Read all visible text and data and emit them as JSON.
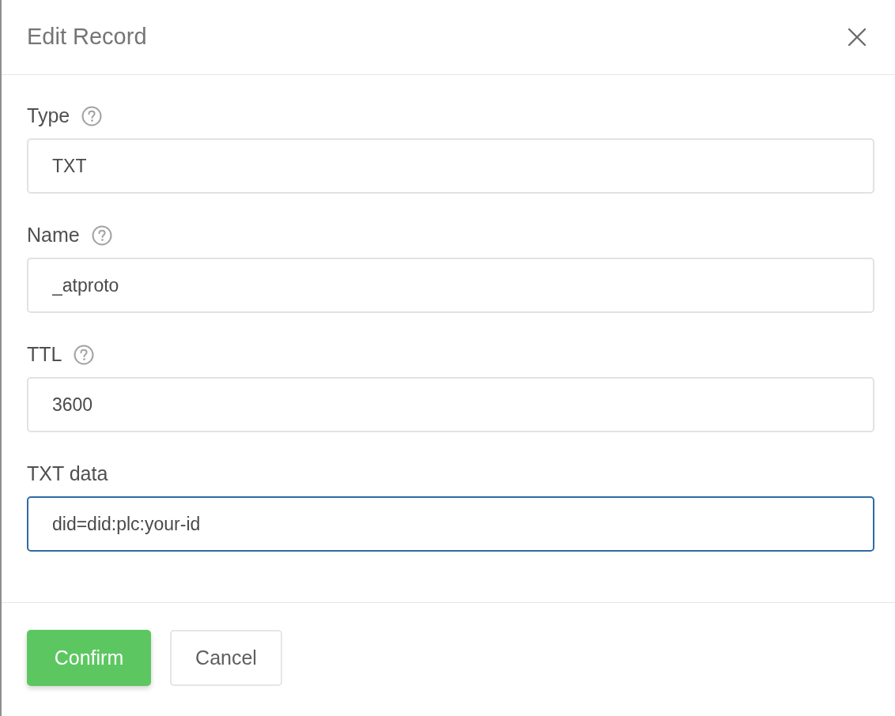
{
  "dialog": {
    "title": "Edit Record"
  },
  "fields": [
    {
      "label": "Type",
      "help": true,
      "value": "TXT",
      "focused": false
    },
    {
      "label": "Name",
      "help": true,
      "value": "_atproto",
      "focused": false
    },
    {
      "label": "TTL",
      "help": true,
      "value": "3600",
      "focused": false
    },
    {
      "label": "TXT data",
      "help": false,
      "value": "did=did:plc:your-id",
      "focused": true
    }
  ],
  "buttons": [
    {
      "label": "Confirm",
      "kind": "primary"
    },
    {
      "label": "Cancel",
      "kind": "secondary"
    }
  ]
}
